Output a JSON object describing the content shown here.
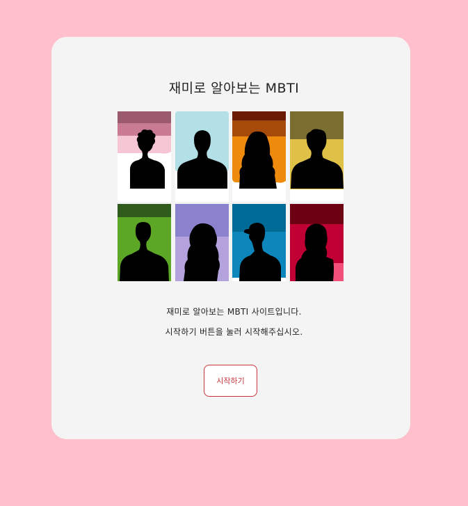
{
  "header": {
    "title": "재미로 알아보는 MBTI"
  },
  "intro": {
    "line1": "재미로 알아보는 MBTI 사이트입니다.",
    "line2": "시작하기 버튼을 눌러 시작해주십시오."
  },
  "actions": {
    "start_label": "시작하기"
  },
  "portraits": [
    {
      "icon": "person-silhouette-icon",
      "bg_colors": [
        "#9c5a6e",
        "#c97b93",
        "#f7c6d5",
        "#ffffff"
      ]
    },
    {
      "icon": "person-silhouette-icon",
      "bg_colors": [
        "#b3dfe6",
        "#ffffff"
      ]
    },
    {
      "icon": "person-silhouette-icon",
      "bg_colors": [
        "#6b1a06",
        "#a74b0a",
        "#ee8a0c",
        "#ffffff"
      ]
    },
    {
      "icon": "person-silhouette-icon",
      "bg_colors": [
        "#7c6e31",
        "#e0c147",
        "#ffffff"
      ]
    },
    {
      "icon": "person-silhouette-icon",
      "bg_colors": [
        "#2f5b1c",
        "#5da727"
      ]
    },
    {
      "icon": "person-silhouette-icon",
      "bg_colors": [
        "#8a82cc",
        "#b3a2dc"
      ]
    },
    {
      "icon": "person-silhouette-icon",
      "bg_colors": [
        "#006b97",
        "#0c86bb"
      ]
    },
    {
      "icon": "person-silhouette-icon",
      "bg_colors": [
        "#6e0013",
        "#c00034",
        "#f2507a"
      ]
    }
  ]
}
